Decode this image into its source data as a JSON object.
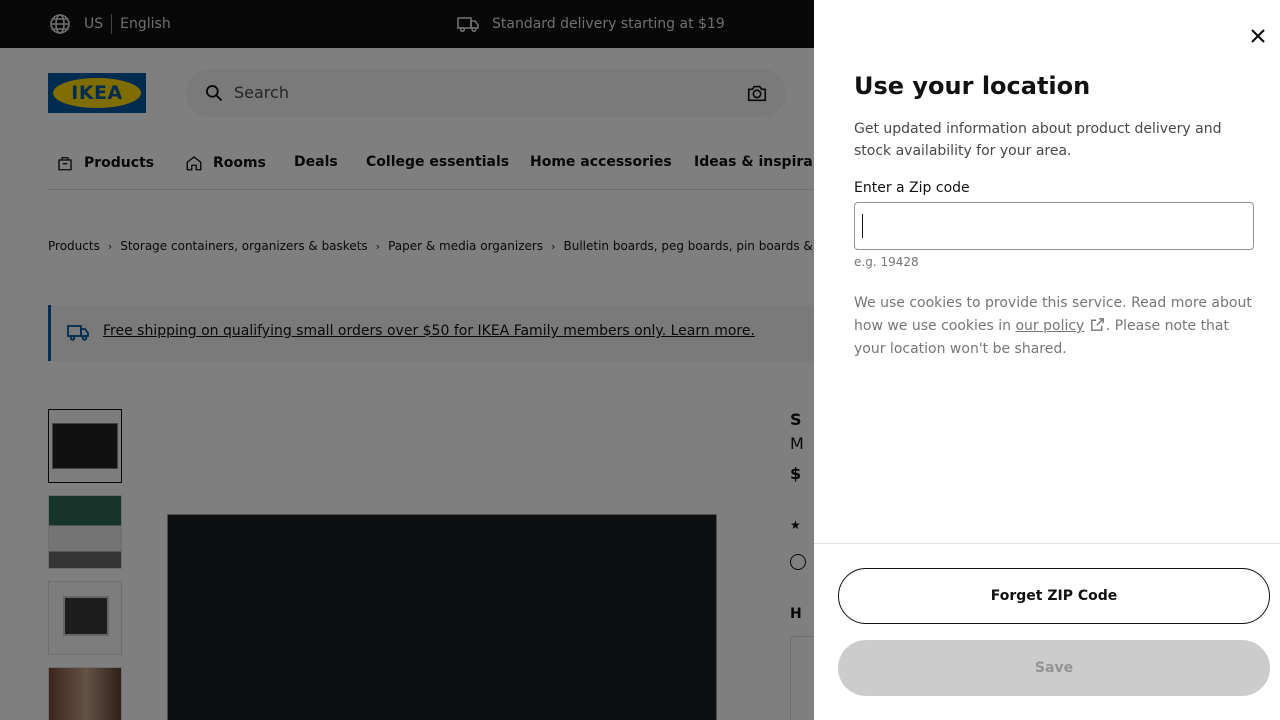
{
  "topbar": {
    "region": "US",
    "language": "English",
    "delivery_text": "Standard delivery starting at $19"
  },
  "header": {
    "logo_text": "IKEA",
    "search_placeholder": "Search"
  },
  "nav": {
    "items": [
      {
        "label": "Products",
        "icon": "store-icon"
      },
      {
        "label": "Rooms",
        "icon": "home-icon"
      },
      {
        "label": "Deals"
      },
      {
        "label": "College essentials"
      },
      {
        "label": "Home accessories"
      },
      {
        "label": "Ideas & inspira"
      }
    ]
  },
  "breadcrumb": [
    "Products",
    "Storage containers, organizers & baskets",
    "Paper & media organizers",
    "Bulletin boards, peg boards, pin boards &"
  ],
  "banner": {
    "text": "Free shipping on qualifying small orders over $50 for IKEA Family members only. Learn more."
  },
  "product": {
    "name_partial": "S",
    "subtitle_partial": "M",
    "price_partial": "$",
    "section_partial": "H"
  },
  "modal": {
    "title": "Use your location",
    "description": "Get updated information about product delivery and stock availability for your area.",
    "zip_label": "Enter a Zip code",
    "zip_value": "",
    "zip_hint": "e.g. 19428",
    "cookie_before": "We use cookies to provide this service. Read more about how we use cookies in ",
    "cookie_link": "our policy",
    "cookie_after": ". Please note that your location won't be shared.",
    "forget_button": "Forget ZIP Code",
    "save_button": "Save"
  },
  "colors": {
    "brand_blue": "#0058a3",
    "brand_yellow": "#ffdb00",
    "topbar_bg": "#111111",
    "overlay": "rgba(0,0,0,0.5)",
    "save_disabled": "#cccccc"
  }
}
